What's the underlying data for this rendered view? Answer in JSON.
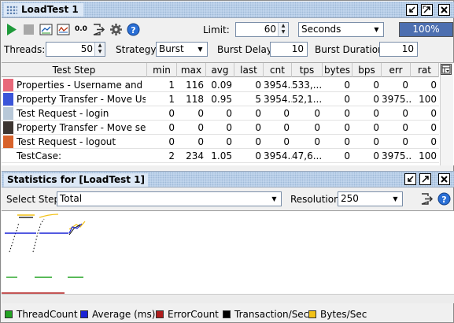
{
  "window": {
    "title": "LoadTest 1"
  },
  "toolbar": {
    "limit_label": "Limit:",
    "limit_value": "60",
    "limit_unit": "Seconds",
    "progress_value": 1.0,
    "progress_text": "100%",
    "zero_label": "0.0"
  },
  "settings": {
    "threads_label": "Threads:",
    "threads_value": "50",
    "strategy_label": "Strategy",
    "strategy_value": "Burst",
    "burst_delay_label": "Burst Delay",
    "burst_delay_value": "10",
    "burst_duration_label": "Burst Duration",
    "burst_duration_value": "10"
  },
  "table": {
    "headers": [
      "Test Step",
      "min",
      "max",
      "avg",
      "last",
      "cnt",
      "tps",
      "bytes",
      "bps",
      "err",
      "rat"
    ],
    "rows": [
      {
        "color": "#e8697a",
        "step": "Properties - Username and P...",
        "min": "1",
        "max": "116",
        "avg": "0.09",
        "last": "0",
        "cnt": "3954...",
        "tps": "533,...",
        "bytes": "0",
        "bps": "0",
        "err": "0",
        "rat": "0"
      },
      {
        "color": "#3b55d9",
        "step": "Property Transfer - Move Use...",
        "min": "1",
        "max": "118",
        "avg": "0.95",
        "last": "5",
        "cnt": "3954...",
        "tps": "52,1...",
        "bytes": "0",
        "bps": "0",
        "err": "3975...",
        "rat": "100"
      },
      {
        "color": "#b8c8d8",
        "step": "Test Request - login",
        "min": "0",
        "max": "0",
        "avg": "0",
        "last": "0",
        "cnt": "0",
        "tps": "0",
        "bytes": "0",
        "bps": "0",
        "err": "0",
        "rat": "0"
      },
      {
        "color": "#3d3530",
        "step": "Property Transfer - Move ses...",
        "min": "0",
        "max": "0",
        "avg": "0",
        "last": "0",
        "cnt": "0",
        "tps": "0",
        "bytes": "0",
        "bps": "0",
        "err": "0",
        "rat": "0"
      },
      {
        "color": "#d8622a",
        "step": "Test Request - logout",
        "min": "0",
        "max": "0",
        "avg": "0",
        "last": "0",
        "cnt": "0",
        "tps": "0",
        "bytes": "0",
        "bps": "0",
        "err": "0",
        "rat": "0"
      },
      {
        "color": "",
        "step": "TestCase:",
        "min": "2",
        "max": "234",
        "avg": "1.05",
        "last": "0",
        "cnt": "3954...",
        "tps": "47,6...",
        "bytes": "0",
        "bps": "0",
        "err": "3975...",
        "rat": "100"
      }
    ]
  },
  "statistics": {
    "title": "Statistics for [LoadTest 1]",
    "select_step_label": "Select Step:",
    "select_step_value": "Total",
    "resolution_label": "Resolution:",
    "resolution_value": "250"
  },
  "legend": [
    {
      "name": "ThreadCount",
      "color": "#22a322"
    },
    {
      "name": "Average (ms)",
      "color": "#1a23d6"
    },
    {
      "name": "ErrorCount",
      "color": "#b01d1d"
    },
    {
      "name": "Transaction/Sec",
      "color": "#000000"
    },
    {
      "name": "Bytes/Sec",
      "color": "#f3c217"
    }
  ]
}
